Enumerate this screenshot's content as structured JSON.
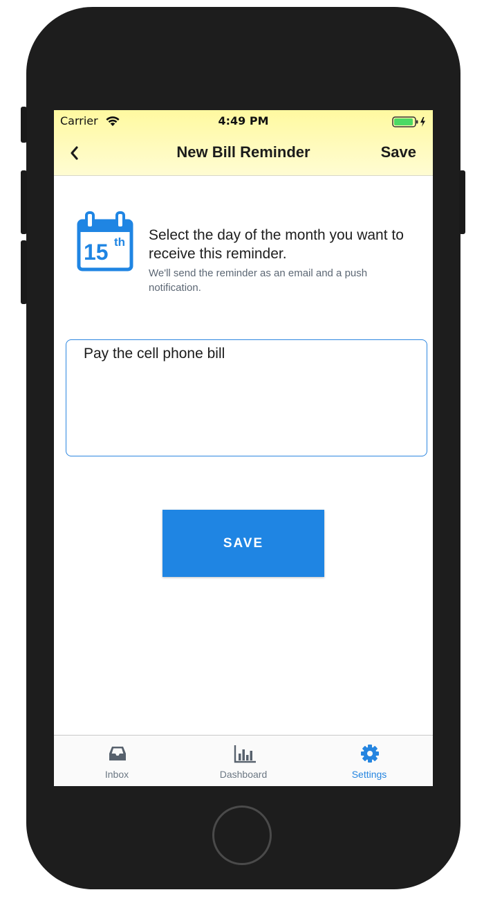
{
  "status_bar": {
    "carrier": "Carrier",
    "time": "4:49 PM",
    "battery_color": "#4cd964"
  },
  "nav": {
    "back_icon": "chevron-left-icon",
    "title": "New Bill Reminder",
    "save_label": "Save"
  },
  "info": {
    "calendar_icon": "calendar-icon",
    "calendar_day": "15",
    "calendar_suffix": "th",
    "heading": "Select the day of the month you want to receive this reminder.",
    "subtext": "We'll send the reminder as an email and a push notification."
  },
  "reminder_input": {
    "value": "Pay the cell phone bill"
  },
  "save_button": {
    "label": "SAVE",
    "color": "#1f85e3"
  },
  "tabbar": {
    "tabs": [
      {
        "label": "Inbox",
        "icon": "inbox-icon",
        "active": false
      },
      {
        "label": "Dashboard",
        "icon": "bar-chart-icon",
        "active": false
      },
      {
        "label": "Settings",
        "icon": "gear-icon",
        "active": true
      }
    ],
    "active_color": "#2585e0",
    "inactive_color": "#6b7783"
  },
  "colors": {
    "accent": "#1f85e3",
    "header_bg": "#fffbbf"
  }
}
